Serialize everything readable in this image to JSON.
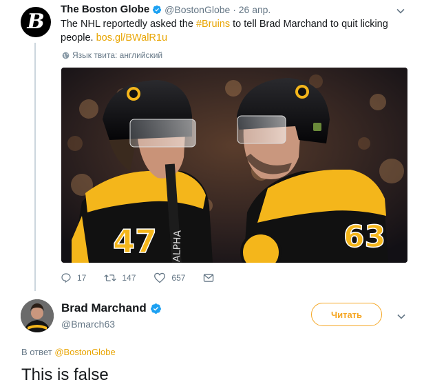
{
  "tweet": {
    "author_name": "The Boston Globe",
    "handle_date": "@BostonGlobe · 26 апр.",
    "avatar_letter": "B",
    "text_before": "The NHL reportedly asked the ",
    "hashtag": "#Bruins",
    "text_after": " to tell Brad Marchand to quit licking people. ",
    "link": "bos.gl/BWalR1u",
    "language_note": "Язык твита: английский",
    "jersey_left": "47",
    "jersey_right": "63",
    "replies": "17",
    "retweets": "147",
    "likes": "657"
  },
  "reply": {
    "author_name": "Brad Marchand",
    "handle": "@Bmarch63",
    "follow_label": "Читать",
    "reply_prefix": "В ответ",
    "reply_target": "@BostonGlobe",
    "text": "This is false"
  },
  "colors": {
    "accent": "#f5a623",
    "hashtag": "#e8a400",
    "verified": "#1da1f2",
    "muted": "#657786",
    "bruins_gold": "#f4b61b"
  },
  "icons": [
    "globe-icon",
    "reply-icon",
    "retweet-icon",
    "like-icon",
    "dm-icon",
    "verified-icon",
    "chevron-down-icon"
  ]
}
